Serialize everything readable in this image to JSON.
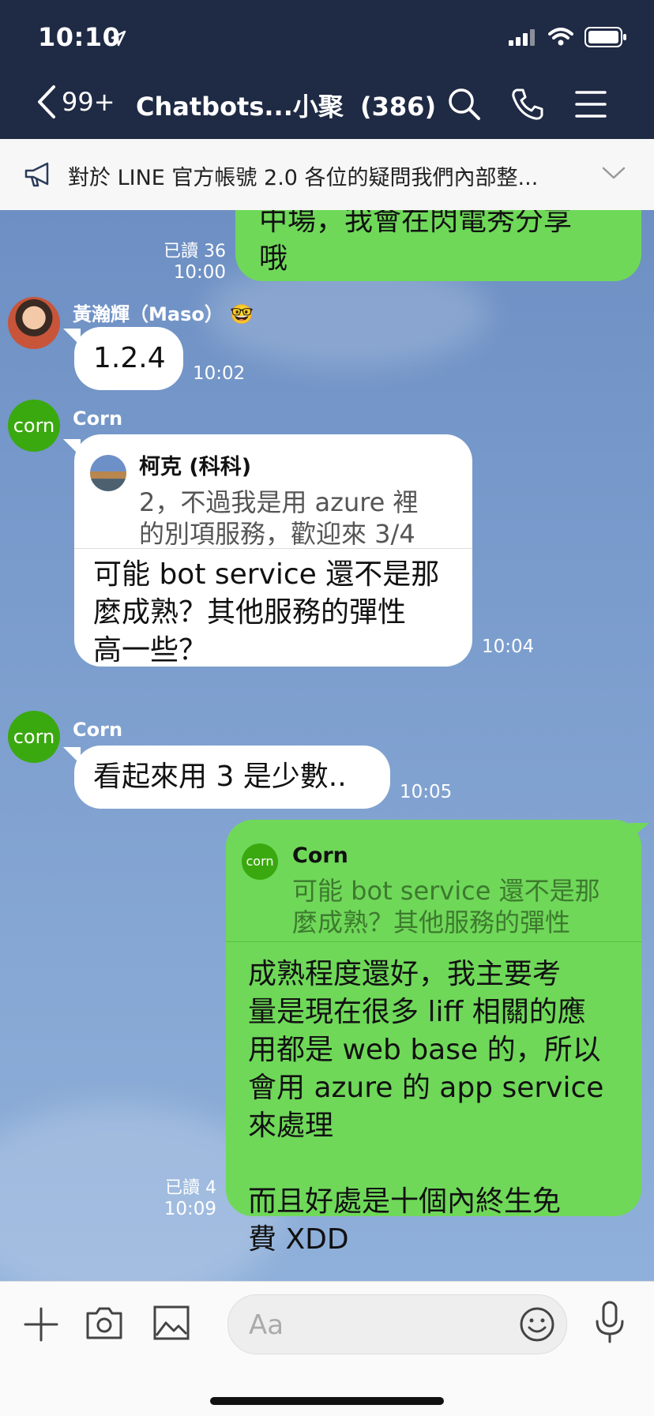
{
  "status": {
    "time": "10:10"
  },
  "header": {
    "back_count": "99+",
    "title": "Chatbots...小聚",
    "member_count": "(386)"
  },
  "announcement": {
    "text": "對於 LINE 官方帳號 2.0 各位的疑問我們內部整..."
  },
  "messages": {
    "m1": {
      "text": "中場，我會在閃電秀分享\n哦",
      "read": "已讀 36",
      "time": "10:00"
    },
    "m2": {
      "sender": "黃瀚輝（Maso）",
      "sender_emoji": "🤓",
      "text": "1.2.4",
      "time": "10:02"
    },
    "m3": {
      "sender": "Corn",
      "avatar_label": "corn",
      "quote_name": "柯克 (科科)",
      "quote_text": "2，不過我是用 azure 裡\n的別項服務，歡迎來 3/4",
      "text": "可能 bot service 還不是那\n麼成熟？其他服務的彈性\n高一些？",
      "time": "10:04"
    },
    "m4": {
      "sender": "Corn",
      "avatar_label": "corn",
      "text": "看起來用 3 是少數..",
      "time": "10:05"
    },
    "m5": {
      "quote_avatar_label": "corn",
      "quote_name": "Corn",
      "quote_text": "可能 bot service 還不是那\n麼成熟？其他服務的彈性",
      "text": "成熟程度還好，我主要考\n量是現在很多 liff 相關的應\n用都是 web base 的，所以\n會用 azure 的 app service\n來處理\n\n而且好處是十個內終生免\n費 XDD",
      "read": "已讀 4",
      "time": "10:09"
    }
  },
  "input": {
    "placeholder": "Aa"
  },
  "colors": {
    "header_bg": "#1f2a44",
    "bubble_green": "#6fd859",
    "corn_green": "#3aa90f"
  }
}
